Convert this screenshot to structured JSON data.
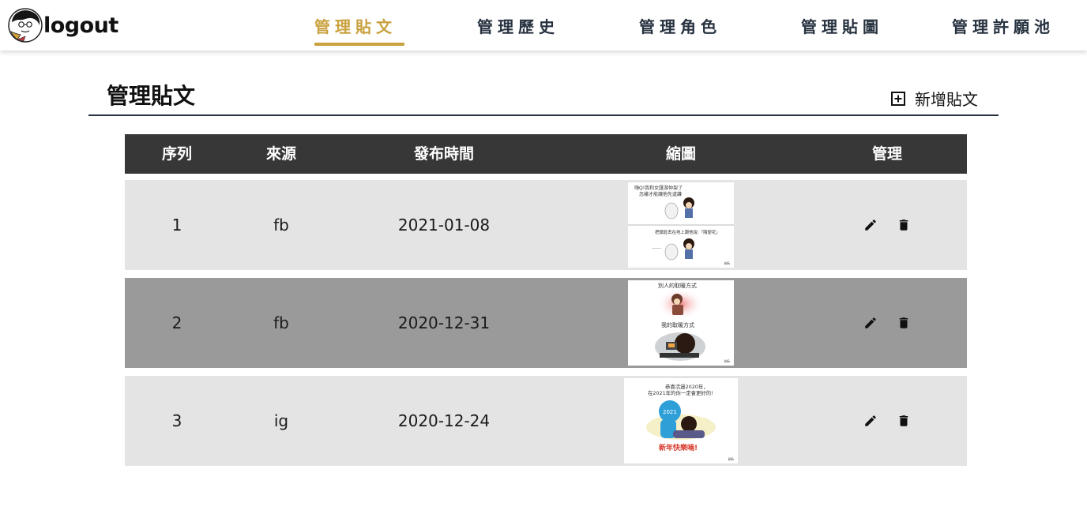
{
  "brand": {
    "logo_text": "logout"
  },
  "nav": [
    {
      "label": "管理貼文",
      "active": true
    },
    {
      "label": "管理歷史",
      "active": false
    },
    {
      "label": "管理角色",
      "active": false
    },
    {
      "label": "管理貼圖",
      "active": false
    },
    {
      "label": "管理許願池",
      "active": false
    }
  ],
  "page": {
    "title": "管理貼文",
    "add_label": "新增貼文"
  },
  "table": {
    "headers": [
      "序列",
      "來源",
      "發布時間",
      "縮圖",
      "管理"
    ],
    "rows": [
      {
        "index": "1",
        "source": "fb",
        "date": "2021-01-08",
        "thumb_text": [
          "嗨Q!我和女匯游仲架了",
          "怎樣才能讓他先道謙",
          "把鎖匙丟在地上跟他說:「隨便花」",
          "……",
          "粉&"
        ]
      },
      {
        "index": "2",
        "source": "fb",
        "date": "2020-12-31",
        "thumb_text": [
          "別人的取暖方式",
          "我的取暖方式",
          "粉&"
        ]
      },
      {
        "index": "3",
        "source": "ig",
        "date": "2020-12-24",
        "thumb_text": [
          "恭喜活過2020年，",
          "在2021年的你一定會更好的!",
          "2021",
          "新年快樂喃!",
          "粉&"
        ]
      }
    ]
  },
  "colors": {
    "accent": "#c9a13f",
    "nav_text": "#273240",
    "header_bg": "#373737",
    "row_light": "#e4e4e4",
    "row_dark": "#9b9a9a"
  },
  "icons": {
    "add": "add-box-icon",
    "edit": "pencil-icon",
    "delete": "trash-icon"
  }
}
